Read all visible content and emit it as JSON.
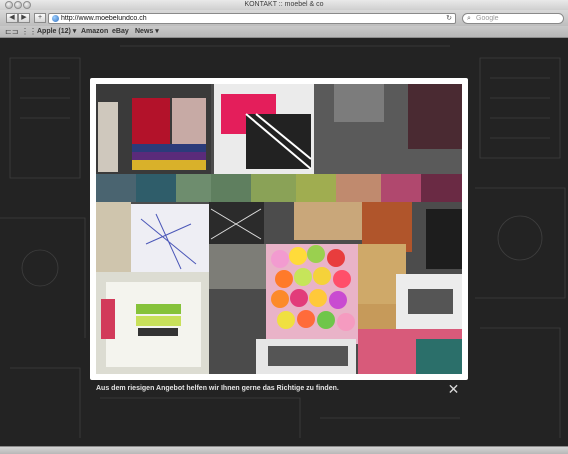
{
  "window": {
    "title": "KONTAKT :: moebel & co"
  },
  "toolbar": {
    "back_icon": "back-arrow-icon",
    "forward_icon": "forward-arrow-icon",
    "add_icon": "plus-icon",
    "url": "http://www.moebelundco.ch",
    "search_placeholder": "Google"
  },
  "bookmarks": {
    "items": [
      {
        "label": "Apple (12) ▾"
      },
      {
        "label": "Amazon"
      },
      {
        "label": "eBay"
      },
      {
        "label": "News ▾"
      }
    ]
  },
  "lightbox": {
    "caption": "Aus dem riesigen Angebot helfen wir Ihnen gerne das Richtige zu finden.",
    "close_icon": "close-x-icon"
  },
  "colors": {
    "page_bg": "#232323",
    "lightbox_frame": "#ffffff",
    "caption": "#e2e2e2"
  }
}
